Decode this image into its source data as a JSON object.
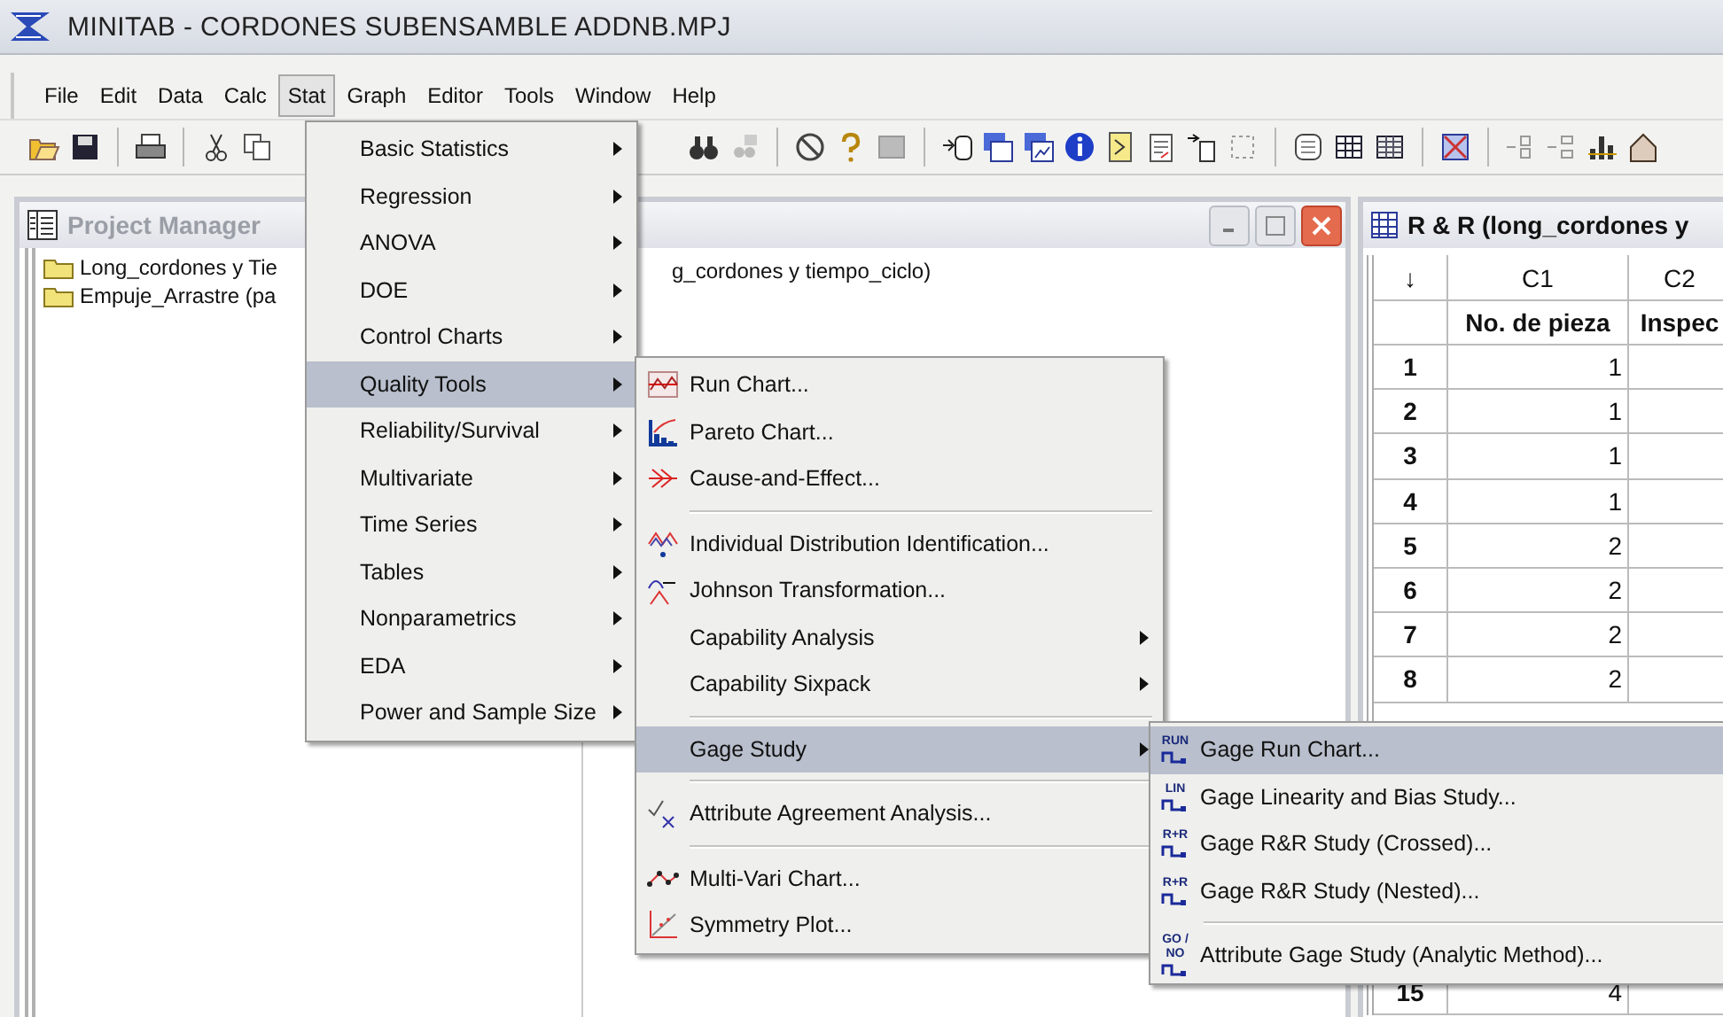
{
  "window": {
    "title": "MINITAB - CORDONES SUBENSAMBLE ADDNB.MPJ"
  },
  "menu_bar": [
    {
      "label": "File",
      "selected": false
    },
    {
      "label": "Edit",
      "selected": false
    },
    {
      "label": "Data",
      "selected": false
    },
    {
      "label": "Calc",
      "selected": false
    },
    {
      "label": "Stat",
      "selected": true
    },
    {
      "label": "Graph",
      "selected": false
    },
    {
      "label": "Editor",
      "selected": false
    },
    {
      "label": "Tools",
      "selected": false
    },
    {
      "label": "Window",
      "selected": false
    },
    {
      "label": "Help",
      "selected": false
    }
  ],
  "project_manager": {
    "title": "Project Manager",
    "tree": [
      {
        "label": "Long_cordones y Tie"
      },
      {
        "label": "Empuje_Arrastre (pa"
      }
    ],
    "detail": "g_cordones y tiempo_ciclo)"
  },
  "worksheet": {
    "title": "R & R (long_cordones y",
    "sort_marker": "↓",
    "columns": [
      {
        "id": "C1",
        "name": "No. de pieza"
      },
      {
        "id": "C2",
        "name": "Inspec"
      }
    ],
    "rows": [
      {
        "row": "1",
        "c1": "1",
        "gap_before": false
      },
      {
        "row": "2",
        "c1": "1",
        "gap_before": false
      },
      {
        "row": "3",
        "c1": "1",
        "gap_before": false
      },
      {
        "row": "4",
        "c1": "1",
        "gap_before": false
      },
      {
        "row": "5",
        "c1": "2",
        "gap_before": false
      },
      {
        "row": "6",
        "c1": "2",
        "gap_before": false
      },
      {
        "row": "7",
        "c1": "2",
        "gap_before": false
      },
      {
        "row": "8",
        "c1": "2",
        "gap_before": false
      },
      {
        "row": "15",
        "c1": "4",
        "gap_before": true
      }
    ]
  },
  "stat_menu": {
    "items": [
      {
        "label": "Basic Statistics",
        "submenu": true,
        "selected": false
      },
      {
        "label": "Regression",
        "submenu": true,
        "selected": false
      },
      {
        "label": "ANOVA",
        "submenu": true,
        "selected": false
      },
      {
        "label": "DOE",
        "submenu": true,
        "selected": false
      },
      {
        "label": "Control Charts",
        "submenu": true,
        "selected": false
      },
      {
        "label": "Quality Tools",
        "submenu": true,
        "selected": true
      },
      {
        "label": "Reliability/Survival",
        "submenu": true,
        "selected": false
      },
      {
        "label": "Multivariate",
        "submenu": true,
        "selected": false
      },
      {
        "label": "Time Series",
        "submenu": true,
        "selected": false
      },
      {
        "label": "Tables",
        "submenu": true,
        "selected": false
      },
      {
        "label": "Nonparametrics",
        "submenu": true,
        "selected": false
      },
      {
        "label": "EDA",
        "submenu": true,
        "selected": false
      },
      {
        "label": "Power and Sample Size",
        "submenu": true,
        "selected": false
      }
    ]
  },
  "quality_tools_menu": {
    "items": [
      {
        "kind": "item",
        "label": "Run Chart...",
        "submenu": false,
        "selected": false
      },
      {
        "kind": "item",
        "label": "Pareto Chart...",
        "submenu": false,
        "selected": false
      },
      {
        "kind": "item",
        "label": "Cause-and-Effect...",
        "submenu": false,
        "selected": false
      },
      {
        "kind": "separator"
      },
      {
        "kind": "item",
        "label": "Individual Distribution Identification...",
        "submenu": false,
        "selected": false
      },
      {
        "kind": "item",
        "label": "Johnson Transformation...",
        "submenu": false,
        "selected": false
      },
      {
        "kind": "item",
        "label": "Capability Analysis",
        "submenu": true,
        "selected": false
      },
      {
        "kind": "item",
        "label": "Capability Sixpack",
        "submenu": true,
        "selected": false
      },
      {
        "kind": "separator"
      },
      {
        "kind": "item",
        "label": "Gage Study",
        "submenu": true,
        "selected": true
      },
      {
        "kind": "separator"
      },
      {
        "kind": "item",
        "label": "Attribute Agreement Analysis...",
        "submenu": false,
        "selected": false
      },
      {
        "kind": "separator"
      },
      {
        "kind": "item",
        "label": "Multi-Vari Chart...",
        "submenu": false,
        "selected": false
      },
      {
        "kind": "item",
        "label": "Symmetry Plot...",
        "submenu": false,
        "selected": false
      }
    ]
  },
  "gage_menu": {
    "items": [
      {
        "kind": "item",
        "badge": "RUN",
        "label": "Gage Run Chart...",
        "selected": true
      },
      {
        "kind": "item",
        "badge": "LIN",
        "label": "Gage Linearity and Bias Study...",
        "selected": false
      },
      {
        "kind": "item",
        "badge": "R+R",
        "label": "Gage R&R Study (Crossed)...",
        "selected": false
      },
      {
        "kind": "item",
        "badge": "R+R",
        "label": "Gage R&R Study (Nested)...",
        "selected": false
      },
      {
        "kind": "separator"
      },
      {
        "kind": "item",
        "badge": "GO / NO",
        "label": "Attribute Gage Study (Analytic Method)...",
        "selected": false
      }
    ]
  }
}
